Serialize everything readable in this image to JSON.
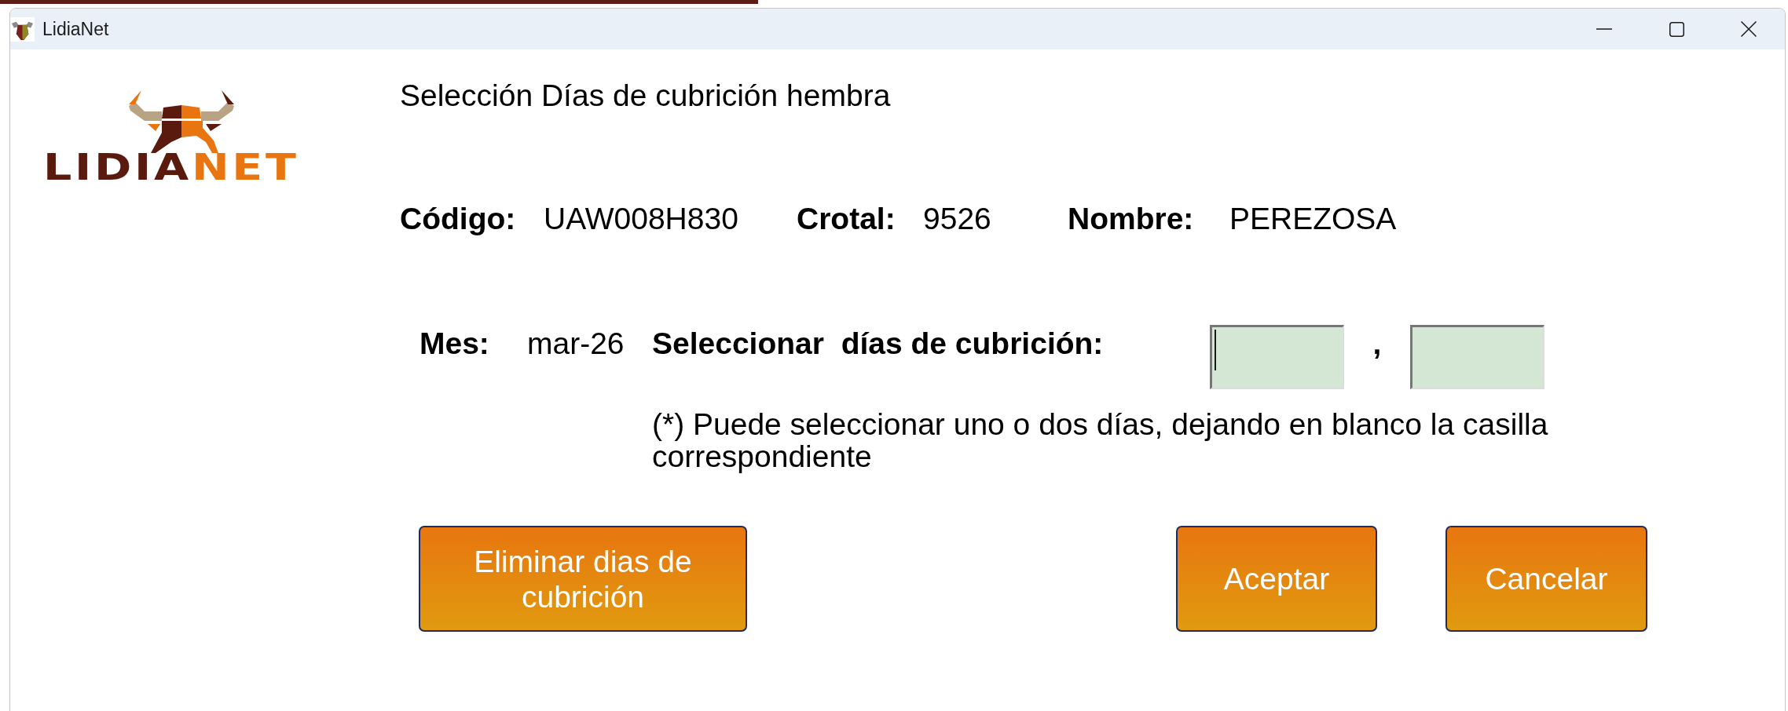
{
  "window": {
    "title": "LidiaNet",
    "controls": [
      {
        "kind": "minimize"
      },
      {
        "kind": "maximize"
      },
      {
        "kind": "close"
      }
    ]
  },
  "logo": {
    "wordmark": [
      {
        "text": "LIDIA",
        "color": "#5b1a0e"
      },
      {
        "text": "NET",
        "color": "#e8750f"
      }
    ]
  },
  "heading": "Selección Días de cubrición hembra",
  "animal": [
    {
      "label": "Código:",
      "value": "UAW008H830"
    },
    {
      "label": "Crotal:",
      "value": "9526"
    },
    {
      "label": "Nombre:",
      "value": "PEREZOSA"
    }
  ],
  "month": {
    "label": "Mes:",
    "value": "mar-26"
  },
  "day_selection": {
    "label": "Seleccionar  días de cubrición:",
    "fields": [
      {
        "focused": true
      },
      {
        "focused": false
      }
    ],
    "separator": ",",
    "note": "(*) Puede seleccionar uno o dos días, dejando en blanco la casilla correspondiente"
  },
  "buttons": [
    {
      "label": "Eliminar dias de cubrición"
    },
    {
      "label": "Aceptar"
    },
    {
      "label": "Cancelar"
    }
  ]
}
